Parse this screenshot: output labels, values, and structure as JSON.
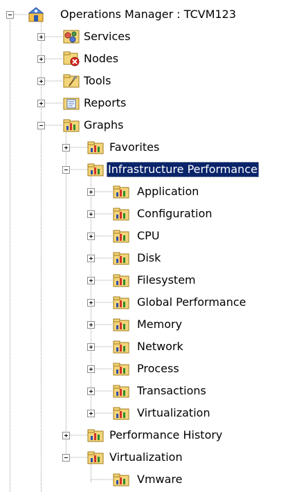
{
  "tree": {
    "root": {
      "label": "Operations Manager : TCVM123",
      "icon": "server-management-icon",
      "expanded": true
    },
    "items": [
      {
        "label": "Services",
        "icon": "services-icon",
        "expanded": false
      },
      {
        "label": "Nodes",
        "icon": "nodes-error-icon",
        "expanded": false
      },
      {
        "label": "Tools",
        "icon": "tools-folder-icon",
        "expanded": false
      },
      {
        "label": "Reports",
        "icon": "reports-folder-icon",
        "expanded": false
      },
      {
        "label": "Graphs",
        "icon": "graph-folder-icon",
        "expanded": true
      },
      {
        "label": "Favorites",
        "icon": "graph-folder-icon",
        "expanded": false
      },
      {
        "label": "Infrastructure Performance",
        "icon": "graph-folder-icon",
        "expanded": true,
        "selected": true
      },
      {
        "label": "Application",
        "icon": "graph-folder-icon",
        "expanded": false
      },
      {
        "label": "Configuration",
        "icon": "graph-folder-icon",
        "expanded": false
      },
      {
        "label": "CPU",
        "icon": "graph-folder-icon",
        "expanded": false
      },
      {
        "label": "Disk",
        "icon": "graph-folder-icon",
        "expanded": false
      },
      {
        "label": "Filesystem",
        "icon": "graph-folder-icon",
        "expanded": false
      },
      {
        "label": "Global Performance",
        "icon": "graph-folder-icon",
        "expanded": false
      },
      {
        "label": "Memory",
        "icon": "graph-folder-icon",
        "expanded": false
      },
      {
        "label": "Network",
        "icon": "graph-folder-icon",
        "expanded": false
      },
      {
        "label": "Process",
        "icon": "graph-folder-icon",
        "expanded": false
      },
      {
        "label": "Transactions",
        "icon": "graph-folder-icon",
        "expanded": false
      },
      {
        "label": "Virtualization",
        "icon": "graph-folder-icon",
        "expanded": false
      },
      {
        "label": "Performance History",
        "icon": "graph-folder-icon",
        "expanded": false
      },
      {
        "label": "Virtualization",
        "icon": "graph-folder-icon",
        "expanded": true
      },
      {
        "label": "Vmware",
        "icon": "graph-folder-icon",
        "expanded": false
      }
    ]
  },
  "colors": {
    "selection_background": "#0a246a",
    "selection_text": "#ffffff",
    "tree_line": "#a0a0a0"
  }
}
